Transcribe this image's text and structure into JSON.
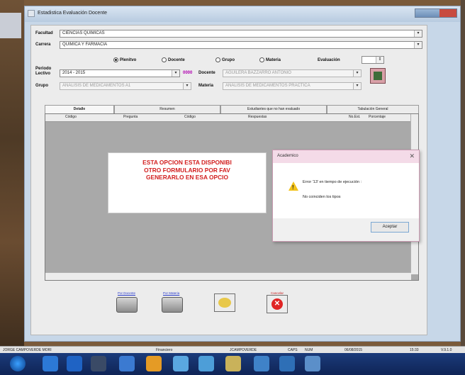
{
  "window": {
    "title": "Estadistica Evaluación Docente"
  },
  "form": {
    "facultad_label": "Facultad",
    "facultad_value": "CIENCIAS QUIMICAS",
    "carrera_label": "Carrera",
    "carrera_value": "QUIMICA Y FARMACIA",
    "radios": [
      {
        "label": "Plenitvo",
        "selected": true
      },
      {
        "label": "Docente",
        "selected": false
      },
      {
        "label": "Grupo",
        "selected": false
      },
      {
        "label": "Materia",
        "selected": false
      }
    ],
    "evaluacion_label": "Evaluación",
    "periodo_label_1": "Periodo",
    "periodo_label_2": "Lectivo",
    "periodo_value": "2014 - 2015",
    "periodo_badge": "0000",
    "docente_label": "Docente",
    "docente_value": "AGUILERA BAZZARRO ANTONIO",
    "grupo_label": "Grupo",
    "grupo_value": "ANALISIS DE MEDICAMENTOS A1",
    "materia_label": "Materia",
    "materia_value": "ANALISIS DE MEDICAMENTOS PRACTICA"
  },
  "tabs": [
    "Detalle",
    "Resumen",
    "Estudiantes que no han evaluado",
    "Tabulación General"
  ],
  "grid": {
    "headers": [
      "Código",
      "Pregunta",
      "Código",
      "Respuestas",
      "No.Est.",
      "Porcentaje"
    ]
  },
  "notice": {
    "line1": "ESTA OPCION ESTA DISPONIBI",
    "line2": "OTRO FORMULARIO POR FAV",
    "line3": "GENERARLO EN ESA OPCIO"
  },
  "dialog": {
    "title": "Academico",
    "message1": "Error '13' en tiempo de ejecución :",
    "message2": "No coinciden los tipos",
    "ok_label": "Aceptar"
  },
  "toolbar": {
    "print_docente_label": "Por Docente",
    "print_materia_label": "Por Materia",
    "cancel_label": "Cancelar"
  },
  "statusbar": {
    "user": "JORGE CAMPOVERDE MORI",
    "module": "Financiero",
    "login": "JCAMPOVERDE",
    "caps": "CAPS",
    "num": "NUM",
    "date": "06/08/2015",
    "time": "15:33",
    "version": "V.9.1.0"
  },
  "colors": {
    "notice": "#d21f1f",
    "badge": "#b000b0",
    "taskbar": "#14306a"
  }
}
